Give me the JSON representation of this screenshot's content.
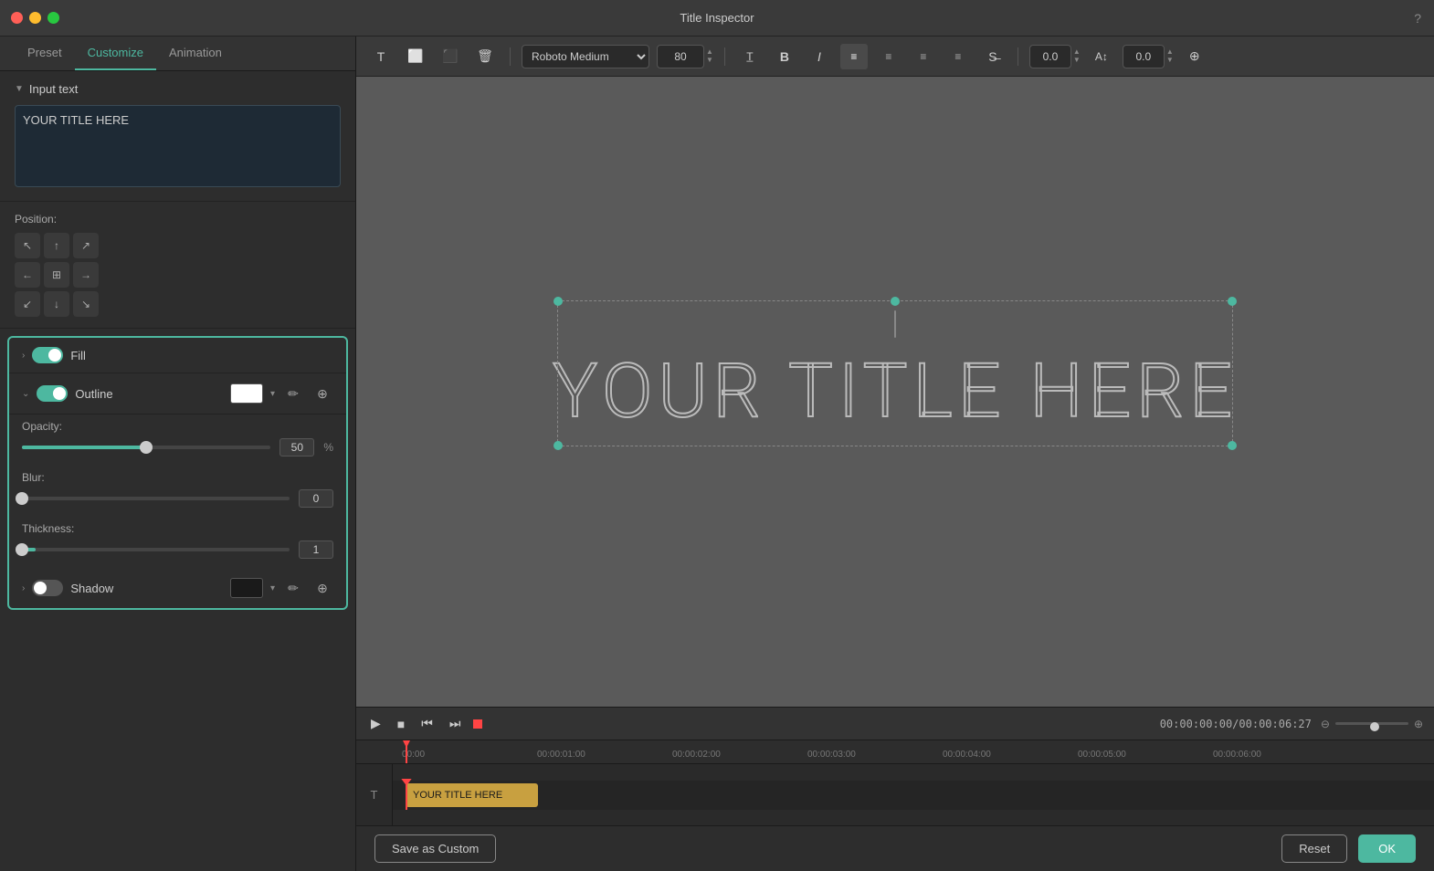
{
  "titlebar": {
    "title": "Title Inspector",
    "question_icon": "?"
  },
  "tabs": {
    "items": [
      {
        "id": "preset",
        "label": "Preset"
      },
      {
        "id": "customize",
        "label": "Customize",
        "active": true
      },
      {
        "id": "animation",
        "label": "Animation"
      }
    ]
  },
  "input_text_section": {
    "title": "Input text",
    "placeholder": "YOUR TITLE HERE",
    "value": "YOUR TITLE HERE"
  },
  "position_section": {
    "label": "Position:"
  },
  "fill_section": {
    "label": "Fill",
    "enabled": true
  },
  "outline_section": {
    "label": "Outline",
    "enabled": true,
    "color": "white",
    "opacity_label": "Opacity:",
    "opacity_value": "50",
    "opacity_unit": "%",
    "blur_label": "Blur:",
    "blur_value": "0",
    "thickness_label": "Thickness:",
    "thickness_value": "1"
  },
  "shadow_section": {
    "label": "Shadow",
    "enabled": false,
    "color": "dark"
  },
  "toolbar": {
    "font_name": "Roboto Medium",
    "font_size": "80",
    "value1": "0.0",
    "value2": "0.0",
    "bold_label": "B",
    "italic_label": "I"
  },
  "canvas": {
    "title_text": "YOUR TITLE HERE"
  },
  "timeline": {
    "time_display": "00:00:00:00/00:00:06:27",
    "ruler_marks": [
      "00:00",
      "00:00:01:00",
      "00:00:02:00",
      "00:00:03:00",
      "00:00:04:00",
      "00:00:05:00",
      "00:00:06:00"
    ],
    "clip_label": "YOUR TITLE HERE"
  },
  "bottom_bar": {
    "save_label": "Save as Custom",
    "reset_label": "Reset",
    "ok_label": "OK"
  }
}
